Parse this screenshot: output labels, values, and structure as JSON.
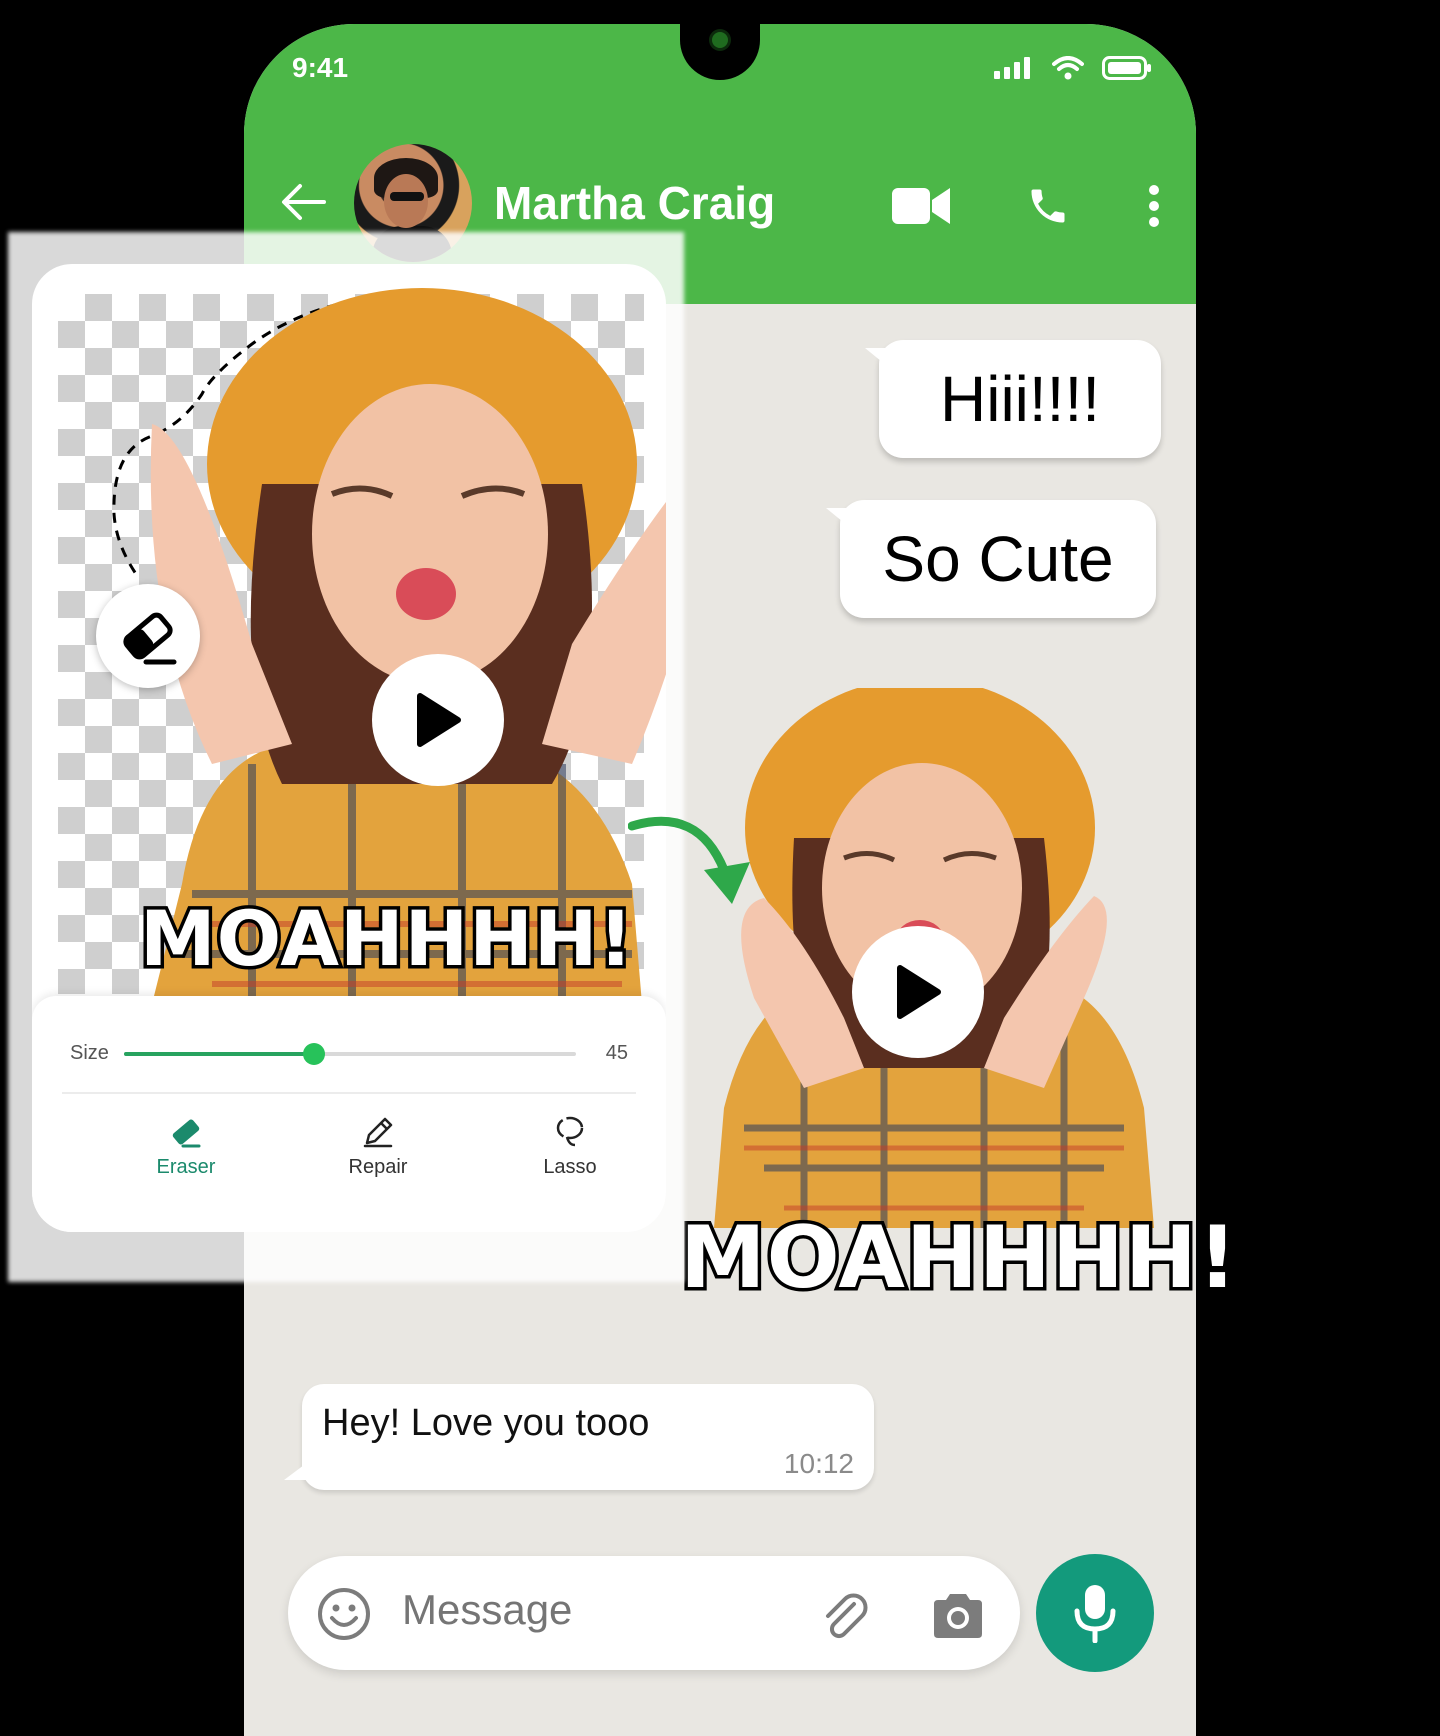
{
  "status_bar": {
    "time": "9:41"
  },
  "chat_header": {
    "contact_name": "Martha Craig"
  },
  "messages": {
    "outgoing": [
      {
        "text": "Hiii!!!!"
      },
      {
        "text": "So Cute"
      }
    ],
    "sticker_caption": "MOAHHHH!",
    "incoming": {
      "text": "Hey! Love you tooo",
      "time": "10:12"
    }
  },
  "composer": {
    "placeholder": "Message"
  },
  "editor": {
    "sticker_caption": "MOAHHHH!",
    "size_label": "Size",
    "size_value": "45",
    "size_fraction": 0.42,
    "tools": [
      {
        "label": "Eraser",
        "icon": "eraser-icon",
        "active": true
      },
      {
        "label": "Repair",
        "icon": "pencil-icon",
        "active": false
      },
      {
        "label": "Lasso",
        "icon": "lasso-icon",
        "active": false
      }
    ]
  },
  "colors": {
    "header_green": "#4cb748",
    "accent_teal": "#139a7c",
    "slider_green": "#27c25a",
    "chat_background": "#e9e7e2"
  }
}
